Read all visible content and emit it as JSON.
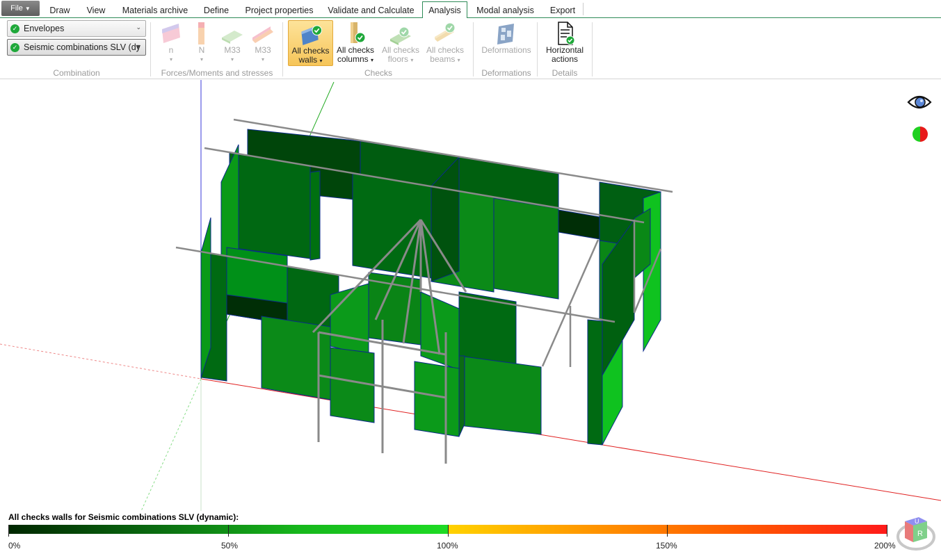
{
  "file_menu": {
    "label": "File"
  },
  "tabs": [
    "Draw",
    "View",
    "Materials archive",
    "Define",
    "Project properties",
    "Validate and Calculate",
    "Analysis",
    "Modal analysis",
    "Export"
  ],
  "active_tab": "Analysis",
  "ribbon": {
    "combination": {
      "envelope_select": "Envelopes",
      "combination_select": "Seismic combinations SLV (dy",
      "group_label": "Combination"
    },
    "forces": {
      "group_label": "Forces/Moments and stresses",
      "buttons": [
        "n",
        "N",
        "M33",
        "M33"
      ]
    },
    "checks": {
      "group_label": "Checks",
      "walls": {
        "line1": "All checks",
        "line2": "walls"
      },
      "columns": {
        "line1": "All checks",
        "line2": "columns"
      },
      "floors": {
        "line1": "All checks",
        "line2": "floors"
      },
      "beams": {
        "line1": "All checks",
        "line2": "beams"
      }
    },
    "deformations": {
      "group_label": "Deformations",
      "button": "Deformations"
    },
    "details": {
      "group_label": "Details",
      "line1": "Horizontal",
      "line2": "actions"
    }
  },
  "legend": {
    "title": "All checks walls for Seismic combinations SLV (dynamic):",
    "ticks": [
      "0%",
      "50%",
      "100%",
      "150%",
      "200%"
    ]
  },
  "colors": {
    "ratio_low": "#002700",
    "ratio_mid": "#17b81c",
    "ratio_limit": "#ffd200",
    "ratio_high": "#ff1a1a",
    "ribbon_selected": "#f6c559",
    "tab_accent": "#2e8b57"
  },
  "view_cube": {
    "faces": [
      "U",
      "R"
    ]
  },
  "icons": [
    "check-circle-icon",
    "eye-icon",
    "legend-toggle-icon",
    "view-cube-icon"
  ]
}
